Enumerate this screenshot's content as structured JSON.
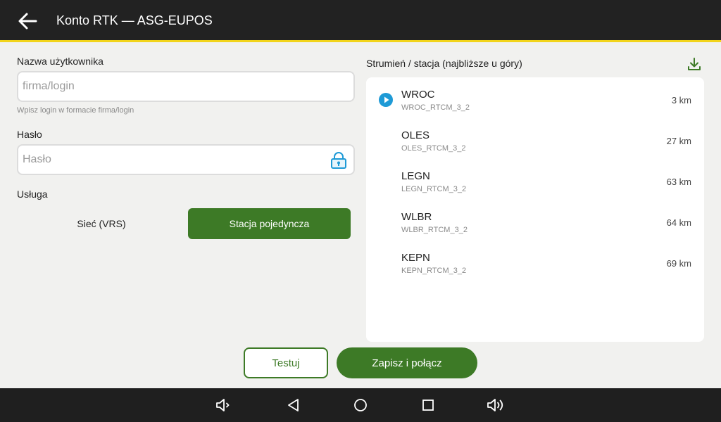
{
  "appbar": {
    "title": "Konto RTK — ASG-EUPOS",
    "back_icon": "arrow-left-icon",
    "accent_line_color": "#f2d41b"
  },
  "form": {
    "username": {
      "label": "Nazwa użytkownika",
      "value": "",
      "placeholder": "firma/login",
      "helper": "Wpisz login w formacie firma/login"
    },
    "password": {
      "label": "Hasło",
      "value": "",
      "placeholder": "Hasło",
      "icon": "lock-icon"
    },
    "service": {
      "label": "Usługa",
      "options": [
        "Sieć (VRS)",
        "Stacja pojedyncza"
      ],
      "selected": "Stacja pojedyncza"
    }
  },
  "stations": {
    "header": "Strumień / stacja (najbliższe u góry)",
    "download_icon": "download-icon",
    "items": [
      {
        "name": "WROC",
        "stream": "WROC_RTCM_3_2",
        "distance": "3 km",
        "selected": true
      },
      {
        "name": "OLES",
        "stream": "OLES_RTCM_3_2",
        "distance": "27 km",
        "selected": false
      },
      {
        "name": "LEGN",
        "stream": "LEGN_RTCM_3_2",
        "distance": "63 km",
        "selected": false
      },
      {
        "name": "WLBR",
        "stream": "WLBR_RTCM_3_2",
        "distance": "64 km",
        "selected": false
      },
      {
        "name": "KEPN",
        "stream": "KEPN_RTCM_3_2",
        "distance": "69 km",
        "selected": false
      }
    ]
  },
  "actions": {
    "test_label": "Testuj",
    "save_label": "Zapisz i połącz"
  },
  "navbar": {
    "icons": [
      "volume-down-icon",
      "back-triangle-icon",
      "home-circle-icon",
      "recents-square-icon",
      "volume-up-icon"
    ]
  },
  "colors": {
    "primary_green": "#3d7a26",
    "accent_blue": "#1e9ad6",
    "appbar_bg": "#222222",
    "navbar_bg": "#1f1f1f"
  }
}
